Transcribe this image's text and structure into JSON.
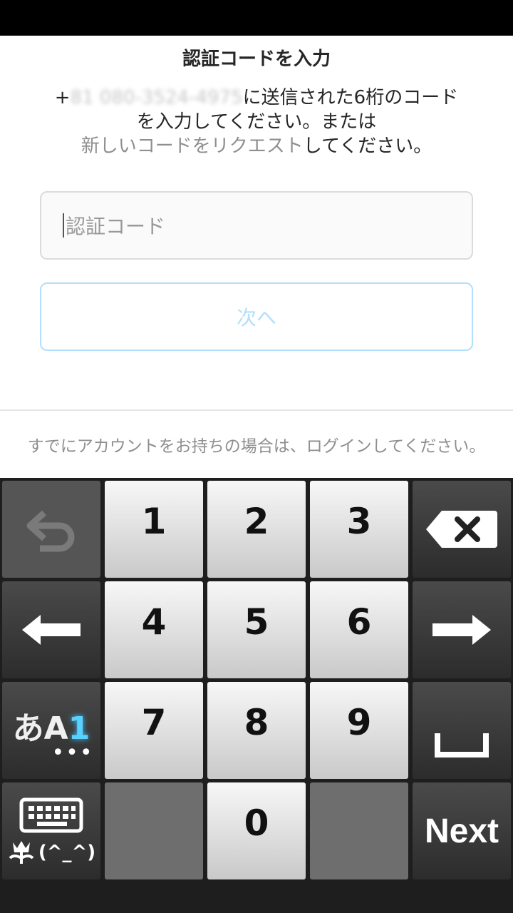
{
  "header": {
    "title": "認証コードを入力"
  },
  "description": {
    "prefix": "+",
    "phone": "81 080-3524-4975",
    "line1_suffix": "に送信された6桁のコード",
    "line2": "を入力してください。または",
    "link": "新しいコードをリクエスト",
    "line3_suffix": "してください。"
  },
  "form": {
    "code_placeholder": "認証コード",
    "next_label": "次へ"
  },
  "footer": {
    "text": "すでにアカウントをお持ちの場合は、ログインしてください。"
  },
  "keyboard": {
    "keys": [
      "1",
      "2",
      "3",
      "4",
      "5",
      "6",
      "7",
      "8",
      "9",
      "0"
    ],
    "mode_label_kana": "あA",
    "mode_label_num": "1",
    "mode_dots": "•••",
    "emoticon": "(^_^)",
    "next_label": "Next"
  },
  "colors": {
    "accent_disabled": "#b2dffc",
    "link_gray": "#8e8e8e"
  }
}
